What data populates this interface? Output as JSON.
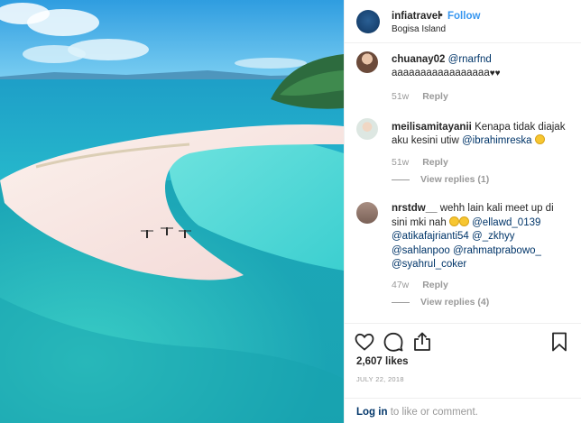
{
  "header": {
    "username": "infiatravel",
    "separator": "•",
    "follow_label": "Follow",
    "location": "Bogisa Island",
    "avatar_color": "#1a4675"
  },
  "comments": [
    {
      "username": "chuanay02",
      "mention": "@rnarfnd",
      "text": "aaaaaaaaaaaaaaaaa",
      "hearts": "♥♥",
      "age": "51w",
      "reply_label": "Reply"
    },
    {
      "username": "meilisamitayanii",
      "text": "Kenapa tidak diajak aku kesini utiw",
      "mention": "@ibrahimreska",
      "age": "51w",
      "reply_label": "Reply",
      "view_replies": "View replies (1)"
    },
    {
      "username": "nrstdw__",
      "text": "wehh lain kali meet up di sini mki nah",
      "mentions": [
        "@ellawd_0139",
        "@atikafajrianti54",
        "@_zkhyy",
        "@sahlanpoo",
        "@rahmatprabowo_",
        "@syahrul_coker"
      ],
      "age": "47w",
      "reply_label": "Reply",
      "view_replies": "View replies (4)"
    }
  ],
  "actions": {
    "likes": "2,607 likes",
    "date": "JULY 22, 2018",
    "login_link": "Log in",
    "login_text": "to like or comment.",
    "icons": [
      "heart-icon",
      "comment-icon",
      "share-icon",
      "bookmark-icon"
    ]
  },
  "colors": {
    "link_blue": "#3897f0",
    "mention_blue": "#003569",
    "muted": "#999999",
    "sea": "#2fc3d0",
    "sand": "#f5e4e0"
  }
}
